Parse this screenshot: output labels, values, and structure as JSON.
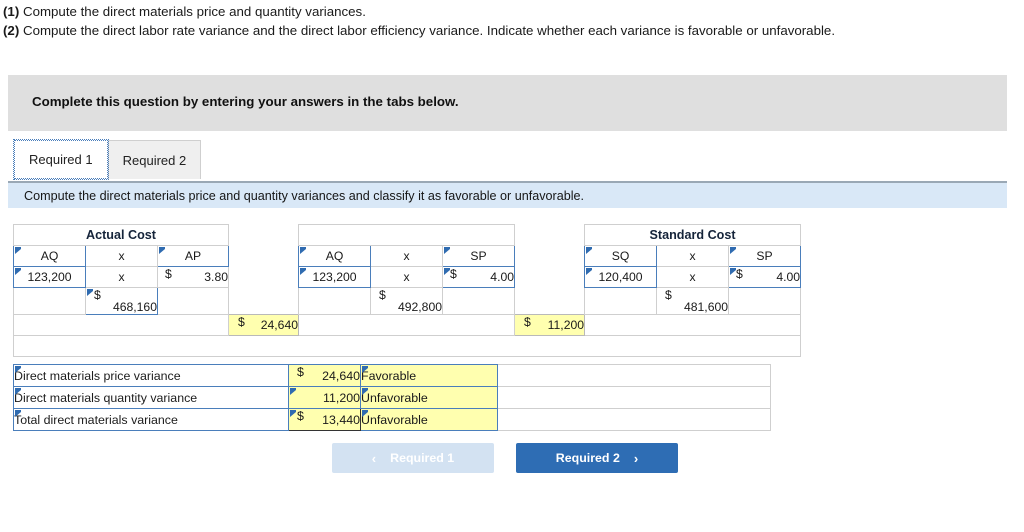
{
  "prompt": {
    "line1_num": "(1)",
    "line1_text": " Compute the direct materials price and quantity variances.",
    "line2_num": "(2)",
    "line2_text": " Compute the direct labor rate variance and the direct labor efficiency variance. Indicate whether each variance is favorable or unfavorable."
  },
  "banner": {
    "text": "Complete this question by entering your answers in the tabs below."
  },
  "tabs": [
    {
      "label": "Required 1",
      "active": true
    },
    {
      "label": "Required 2",
      "active": false
    }
  ],
  "subbar": {
    "text": "Compute the direct materials price and quantity variances and classify it as favorable or unfavorable."
  },
  "grid": {
    "header_actual": "Actual Cost",
    "header_middle": "",
    "header_standard": "Standard Cost",
    "labels_actual": {
      "qty": "AQ",
      "times": "x",
      "price": "AP"
    },
    "labels_middle": {
      "qty": "AQ",
      "times": "x",
      "price": "SP"
    },
    "labels_standard": {
      "qty": "SQ",
      "times": "x",
      "price": "SP"
    },
    "values_actual": {
      "qty": "123,200",
      "times": "x",
      "dollar": "$",
      "price": "3.80"
    },
    "values_middle": {
      "qty": "123,200",
      "times": "x",
      "dollar": "$",
      "price": "4.00"
    },
    "values_standard": {
      "qty": "120,400",
      "times": "x",
      "dollar": "$",
      "price": "4.00"
    },
    "totals": {
      "actual_dollar": "$",
      "actual_total": "468,160",
      "middle_dollar": "$",
      "middle_total": "492,800",
      "standard_dollar": "$",
      "standard_total": "481,600"
    },
    "spreads": {
      "price_dollar": "$",
      "price_variance": "24,640",
      "qty_dollar": "$",
      "qty_variance": "11,200"
    }
  },
  "variances": [
    {
      "label": "Direct materials price variance",
      "dollar": "$",
      "amount": "24,640",
      "status": "Favorable",
      "focused": false
    },
    {
      "label": "Direct materials quantity variance",
      "dollar": "",
      "amount": "11,200",
      "status": "Unfavorable",
      "focused": false
    },
    {
      "label": "Total direct materials variance",
      "dollar": "$",
      "amount": "13,440",
      "status": "Unfavorable",
      "focused": true
    }
  ],
  "nav": {
    "prev_label": "Required 1",
    "prev_chevron": "‹",
    "next_label": "Required 2",
    "next_chevron": "›"
  },
  "colors": {
    "header_blue": "#6fa8dc",
    "cell_border_blue": "#4a7ebb",
    "answer_yellow": "#ffffaf",
    "banner_gray": "#dfdfdf",
    "subbar_blue": "#d9e8f7",
    "button_blue": "#2e6db4",
    "button_disabled": "#d3e2f2"
  }
}
